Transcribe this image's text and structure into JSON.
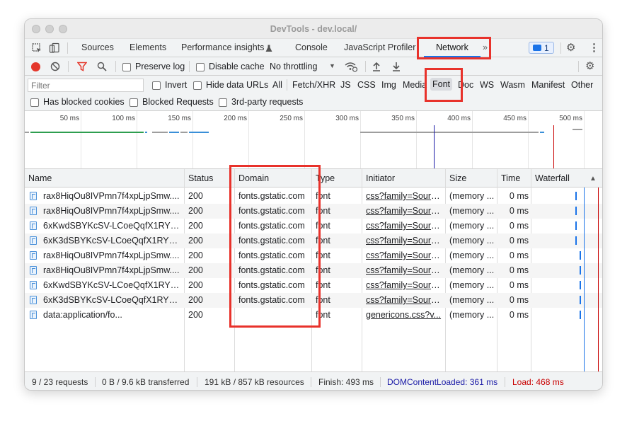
{
  "window": {
    "title": "DevTools - dev.local/"
  },
  "tabs": [
    {
      "label": "Sources"
    },
    {
      "label": "Elements"
    },
    {
      "label": "Performance insights"
    },
    {
      "label": "Console"
    },
    {
      "label": "JavaScript Profiler"
    },
    {
      "label": "Network"
    }
  ],
  "tabbar": {
    "more": "»",
    "badge_count": "1"
  },
  "toolbar": {
    "preserve_log": "Preserve log",
    "disable_cache": "Disable cache",
    "throttling": "No throttling"
  },
  "filter": {
    "placeholder": "Filter",
    "invert": "Invert",
    "hide_data_urls": "Hide data URLs",
    "types": [
      "All",
      "Fetch/XHR",
      "JS",
      "CSS",
      "Img",
      "Media",
      "Font",
      "Doc",
      "WS",
      "Wasm",
      "Manifest",
      "Other"
    ],
    "active_type": "Font",
    "has_blocked_cookies": "Has blocked cookies",
    "blocked_requests": "Blocked Requests",
    "third_party": "3rd-party requests"
  },
  "overview": {
    "ticks": [
      "50 ms",
      "100 ms",
      "150 ms",
      "200 ms",
      "250 ms",
      "300 ms",
      "350 ms",
      "400 ms",
      "450 ms",
      "500 ms"
    ]
  },
  "table": {
    "columns": [
      "Name",
      "Status",
      "Domain",
      "Type",
      "Initiator",
      "Size",
      "Time",
      "Waterfall"
    ],
    "sort_indicator": "▲",
    "rows": [
      {
        "name": "rax8HiqOu8IVPmn7f4xpLjpSmw....",
        "status": "200",
        "domain": "fonts.gstatic.com",
        "type": "font",
        "initiator": "css?family=Sourc...",
        "size": "(memory ...",
        "time": "0 ms"
      },
      {
        "name": "rax8HiqOu8IVPmn7f4xpLjpSmw....",
        "status": "200",
        "domain": "fonts.gstatic.com",
        "type": "font",
        "initiator": "css?family=Sourc...",
        "size": "(memory ...",
        "time": "0 ms"
      },
      {
        "name": "6xKwdSBYKcSV-LCoeQqfX1RYO...",
        "status": "200",
        "domain": "fonts.gstatic.com",
        "type": "font",
        "initiator": "css?family=Sourc...",
        "size": "(memory ...",
        "time": "0 ms"
      },
      {
        "name": "6xK3dSBYKcSV-LCoeQqfX1RYO...",
        "status": "200",
        "domain": "fonts.gstatic.com",
        "type": "font",
        "initiator": "css?family=Sourc...",
        "size": "(memory ...",
        "time": "0 ms"
      },
      {
        "name": "rax8HiqOu8IVPmn7f4xpLjpSmw....",
        "status": "200",
        "domain": "fonts.gstatic.com",
        "type": "font",
        "initiator": "css?family=Sourc...",
        "size": "(memory ...",
        "time": "0 ms"
      },
      {
        "name": "rax8HiqOu8IVPmn7f4xpLjpSmw....",
        "status": "200",
        "domain": "fonts.gstatic.com",
        "type": "font",
        "initiator": "css?family=Sourc...",
        "size": "(memory ...",
        "time": "0 ms"
      },
      {
        "name": "6xKwdSBYKcSV-LCoeQqfX1RYO...",
        "status": "200",
        "domain": "fonts.gstatic.com",
        "type": "font",
        "initiator": "css?family=Sourc...",
        "size": "(memory ...",
        "time": "0 ms"
      },
      {
        "name": "6xK3dSBYKcSV-LCoeQqfX1RYO...",
        "status": "200",
        "domain": "fonts.gstatic.com",
        "type": "font",
        "initiator": "css?family=Sourc...",
        "size": "(memory ...",
        "time": "0 ms"
      },
      {
        "name": "data:application/fo...",
        "status": "200",
        "domain": "",
        "type": "font",
        "initiator": "genericons.css?v...",
        "size": "(memory ...",
        "time": "0 ms"
      }
    ]
  },
  "status": {
    "requests": "9 / 23 requests",
    "transferred": "0 B / 9.6 kB transferred",
    "resources": "191 kB / 857 kB resources",
    "finish": "Finish: 493 ms",
    "dom_content_loaded": "DOMContentLoaded: 361 ms",
    "load": "Load: 468 ms"
  },
  "colors": {
    "accent": "#1a73e8",
    "highlight": "#e8322b",
    "dcl": "#1a1aa6",
    "load": "#c80000"
  }
}
